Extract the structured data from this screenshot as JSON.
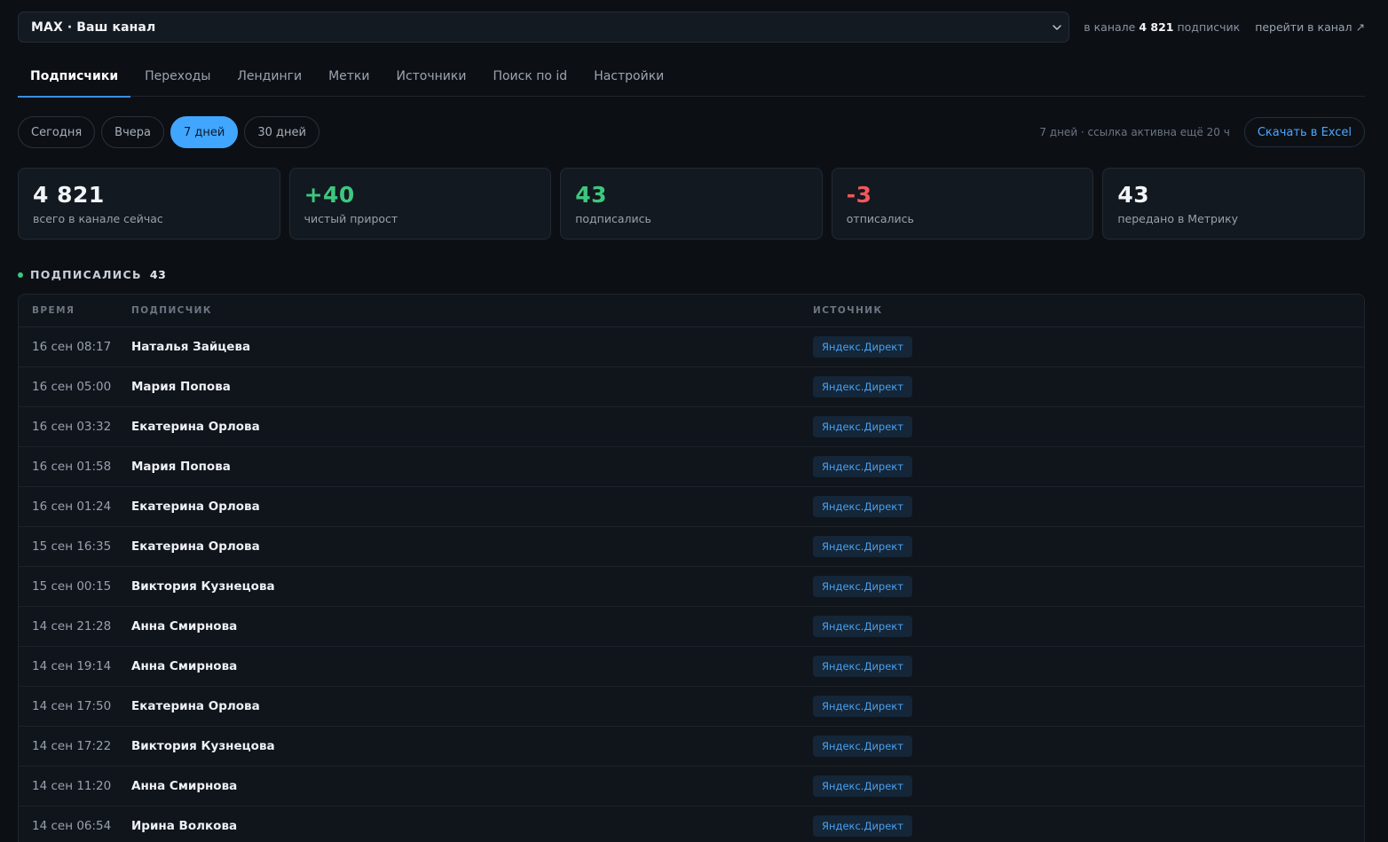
{
  "header": {
    "channel_select_value": "MAX · Ваш канал",
    "sub_count_prefix": "в канале",
    "sub_count_value": "4 821",
    "sub_count_suffix": "подписчик",
    "goto_channel_label": "перейти в канал ↗"
  },
  "tabs": [
    {
      "label": "Подписчики",
      "active": true
    },
    {
      "label": "Переходы"
    },
    {
      "label": "Лендинги"
    },
    {
      "label": "Метки"
    },
    {
      "label": "Источники"
    },
    {
      "label": "Поиск по id"
    },
    {
      "label": "Настройки"
    }
  ],
  "filters": {
    "periods": [
      "Сегодня",
      "Вчера",
      "7 дней",
      "30 дней"
    ],
    "active_period": "7 дней",
    "note": "7 дней · ссылка активна ещё 20 ч",
    "excel_label": "Скачать в Excel"
  },
  "stats": [
    {
      "value": "4 821",
      "label": "всего в канале сейчас",
      "tone": "default"
    },
    {
      "value": "+40",
      "label": "чистый прирост",
      "tone": "green"
    },
    {
      "value": "43",
      "label": "подписались",
      "tone": "green"
    },
    {
      "value": "-3",
      "label": "отписались",
      "tone": "red"
    },
    {
      "value": "43",
      "label": "передано в Метрику",
      "tone": "default"
    }
  ],
  "section": {
    "title": "Подписались",
    "count": "43"
  },
  "table": {
    "columns": [
      "Время",
      "Подписчик",
      "Источник"
    ],
    "rows": [
      {
        "time": "16 сен 08:17",
        "name": "Наталья Зайцева",
        "source": "Яндекс.Директ"
      },
      {
        "time": "16 сен 05:00",
        "name": "Мария Попова",
        "source": "Яндекс.Директ"
      },
      {
        "time": "16 сен 03:32",
        "name": "Екатерина Орлова",
        "source": "Яндекс.Директ"
      },
      {
        "time": "16 сен 01:58",
        "name": "Мария Попова",
        "source": "Яндекс.Директ"
      },
      {
        "time": "16 сен 01:24",
        "name": "Екатерина Орлова",
        "source": "Яндекс.Директ"
      },
      {
        "time": "15 сен 16:35",
        "name": "Екатерина Орлова",
        "source": "Яндекс.Директ"
      },
      {
        "time": "15 сен 00:15",
        "name": "Виктория Кузнецова",
        "source": "Яндекс.Директ"
      },
      {
        "time": "14 сен 21:28",
        "name": "Анна Смирнова",
        "source": "Яндекс.Директ"
      },
      {
        "time": "14 сен 19:14",
        "name": "Анна Смирнова",
        "source": "Яндекс.Директ"
      },
      {
        "time": "14 сен 17:50",
        "name": "Екатерина Орлова",
        "source": "Яндекс.Директ"
      },
      {
        "time": "14 сен 17:22",
        "name": "Виктория Кузнецова",
        "source": "Яндекс.Директ"
      },
      {
        "time": "14 сен 11:20",
        "name": "Анна Смирнова",
        "source": "Яндекс.Директ"
      },
      {
        "time": "14 сен 06:54",
        "name": "Ирина Волкова",
        "source": "Яндекс.Директ"
      }
    ]
  },
  "colors": {
    "accent": "#41a6ff",
    "positive": "#3ec77e",
    "negative": "#f2575a",
    "background": "#0c1015"
  },
  "icons": {
    "select_chevron": "chevron-down-icon",
    "status_dot": "green-dot-icon"
  }
}
